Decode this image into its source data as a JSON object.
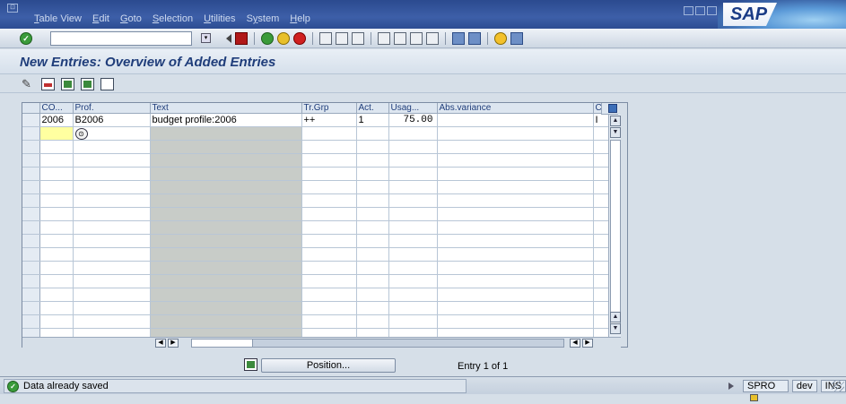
{
  "menu": [
    "Table View",
    "Edit",
    "Goto",
    "Selection",
    "Utilities",
    "System",
    "Help"
  ],
  "menu_underline": [
    "T",
    "E",
    "G",
    "S",
    "U",
    "y",
    "H"
  ],
  "brand": "SAP",
  "command_field": {
    "value": ""
  },
  "title": "New Entries: Overview of Added Entries",
  "table": {
    "headers": [
      "CO...",
      "Prof.",
      "Text",
      "Tr.Grp",
      "Act.",
      "Usag...",
      "Abs.variance",
      "C"
    ],
    "rows": [
      [
        "2006",
        "B2006",
        "budget profile:2006",
        "++",
        "1",
        "75.00",
        "",
        "I"
      ]
    ],
    "empty_rows": 15
  },
  "position_button": "Position...",
  "entry_label": "Entry 1 of 1",
  "status": {
    "message": "Data already saved",
    "transaction": "SPRO",
    "system": "dev",
    "mode": "INS"
  },
  "icons": {
    "ok": "check-icon",
    "save": "save-icon",
    "back": "back-icon",
    "exit": "exit-icon",
    "cancel": "cancel-icon",
    "print": "print-icon",
    "find": "find-icon",
    "find_next": "find-next-icon",
    "help": "help-icon",
    "layout": "layout-icon"
  }
}
